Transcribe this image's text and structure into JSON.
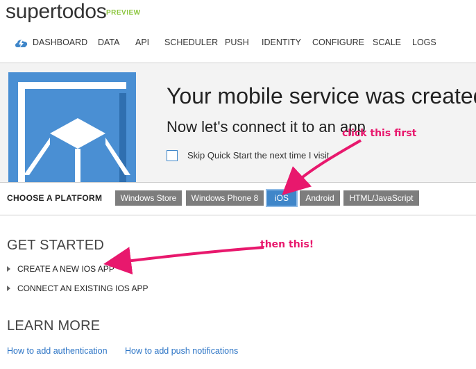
{
  "app": {
    "title": "supertodos",
    "badge": "PREVIEW"
  },
  "nav": {
    "items": [
      "DASHBOARD",
      "DATA",
      "API",
      "SCHEDULER",
      "PUSH",
      "IDENTITY",
      "CONFIGURE",
      "SCALE",
      "LOGS"
    ]
  },
  "banner": {
    "title": "Your mobile service was created.",
    "subtitle": "Now let's connect it to an app",
    "skip_label": "Skip Quick Start the next time I visit"
  },
  "platform": {
    "label": "CHOOSE A PLATFORM",
    "options": [
      "Windows Store",
      "Windows Phone 8",
      "iOS",
      "Android",
      "HTML/JavaScript"
    ],
    "selected": "iOS"
  },
  "get_started": {
    "heading": "GET STARTED",
    "items": [
      "CREATE A NEW IOS APP",
      "CONNECT AN EXISTING IOS APP"
    ]
  },
  "learn_more": {
    "heading": "LEARN MORE",
    "links": [
      "How to add authentication",
      "How to add push notifications"
    ]
  },
  "annotations": {
    "first": "click this first",
    "second": "then this!"
  },
  "colors": {
    "accent": "#3f86c9",
    "annotation": "#e8186d",
    "preview_badge": "#8cc63e"
  },
  "icons": {
    "logo": "cloud-bolt-icon",
    "banner": "mobile-device-icon"
  }
}
